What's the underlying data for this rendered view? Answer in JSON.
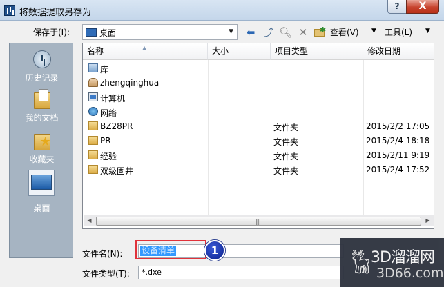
{
  "window": {
    "title": "将数据提取另存为",
    "help_label": "?",
    "close_label": "X"
  },
  "toolbar": {
    "save_in_label": "保存于(I):",
    "location_value": "桌面",
    "view_label": "查看(V)",
    "tools_label": "工具(L)"
  },
  "places": [
    {
      "label": "历史记录",
      "icon": "history-icon"
    },
    {
      "label": "我的文档",
      "icon": "documents-icon"
    },
    {
      "label": "收藏夹",
      "icon": "favorites-icon"
    },
    {
      "label": "桌面",
      "icon": "desktop-icon"
    }
  ],
  "columns": {
    "name": "名称",
    "size": "大小",
    "type": "项目类型",
    "date": "修改日期"
  },
  "files": [
    {
      "name": "库",
      "icon": "library-icon",
      "type": "",
      "date": ""
    },
    {
      "name": "zhengqinghua",
      "icon": "user-icon",
      "type": "",
      "date": ""
    },
    {
      "name": "计算机",
      "icon": "computer-icon",
      "type": "",
      "date": ""
    },
    {
      "name": "网络",
      "icon": "network-icon",
      "type": "",
      "date": ""
    },
    {
      "name": "BZ28PR",
      "icon": "folder-icon",
      "type": "文件夹",
      "date": "2015/2/2 17:05"
    },
    {
      "name": "PR",
      "icon": "folder-icon",
      "type": "文件夹",
      "date": "2015/2/4 18:18"
    },
    {
      "name": "经验",
      "icon": "folder-icon",
      "type": "文件夹",
      "date": "2015/2/11 9:19"
    },
    {
      "name": "双级固井",
      "icon": "folder-icon",
      "type": "文件夹",
      "date": "2015/2/4 17:52"
    }
  ],
  "bottom": {
    "filename_label": "文件名(N):",
    "filename_value": "设备清单",
    "filetype_label": "文件类型(T):",
    "filetype_value": "*.dxe"
  },
  "annotation": {
    "badge": "1"
  },
  "watermark": {
    "brand": "3D溜溜网",
    "url": "3D66.com"
  },
  "colors": {
    "places_bar": "#a6b4c2",
    "selection": "#3399ff",
    "highlight_frame": "#e0323a",
    "badge": "#0a1f8a"
  }
}
